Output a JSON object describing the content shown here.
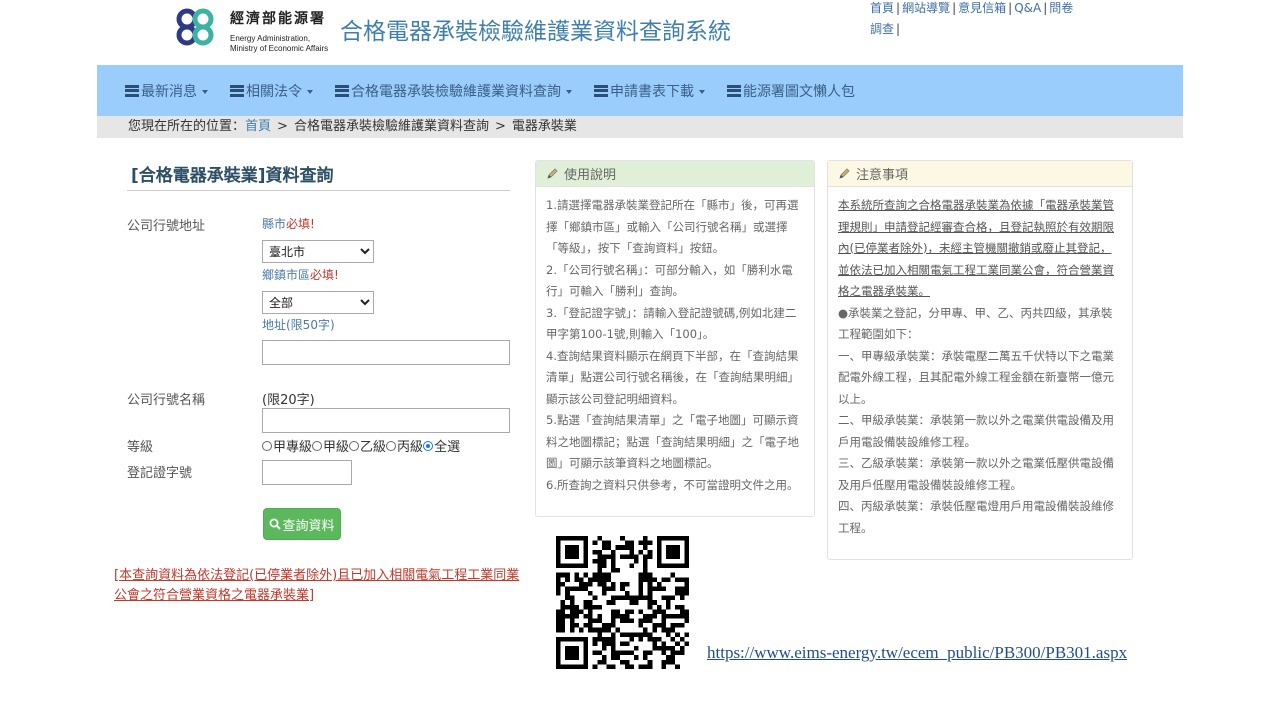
{
  "header": {
    "logo_zh": "經濟部能源署",
    "logo_en_line1": "Energy Administration,",
    "logo_en_line2": "Ministry of Economic Affairs",
    "site_title": "合格電器承裝檢驗維護業資料查詢系統",
    "top_links": [
      "首頁",
      "網站導覽",
      "意見信箱",
      "Q&A",
      "問卷調查"
    ]
  },
  "nav": {
    "items": [
      "最新消息",
      "相關法令",
      "合格電器承裝檢驗維護業資料查詢",
      "申請書表下載",
      "能源署圖文懶人包"
    ]
  },
  "breadcrumb": {
    "prefix": "您現在所在的位置：",
    "home": "首頁",
    "level1": "合格電器承裝檢驗維護業資料查詢",
    "level2": "電器承裝業"
  },
  "form": {
    "title": "[合格電器承裝業]資料查詢",
    "address_label": "公司行號地址",
    "county_label": "縣市",
    "required": "必填!",
    "county_value": "臺北市",
    "district_label": "鄉鎮市區",
    "district_value": "全部",
    "address_hint": "地址(限50字)",
    "address_value": "",
    "name_label": "公司行號名稱",
    "name_hint": "(限20字)",
    "name_value": "",
    "grade_label": "等級",
    "grades": [
      "甲專級",
      "甲級",
      "乙級",
      "丙級",
      "全選"
    ],
    "grade_selected": "全選",
    "reg_label": "登記證字號",
    "reg_value": "",
    "query_button": "查詢資料",
    "red_note": "[本查詢資料為依法登記(已停業者除外)且已加入相關電氣工程工業同業公會之符合營業資格之電器承裝業]"
  },
  "usage": {
    "title": "使用說明",
    "items": [
      "1.請選擇電器承裝業登記所在「縣市」後，可再選擇「鄉鎮市區」或輸入「公司行號名稱」或選擇「等級」，按下「查詢資料」按鈕。",
      "2.「公司行號名稱」：可部分輸入，如「勝利水電行」可輸入「勝利」查詢。",
      "3.「登記證字號」：請輸入登記證號碼,例如北建二甲字第100-1號,則輸入「100」。",
      "4.查詢結果資料顯示在網頁下半部，在「查詢結果清單」點選公司行號名稱後，在「查詢結果明細」顯示該公司登記明細資料。",
      "5.點選「查詢結果清單」之「電子地圖」可顯示資料之地圖標記；點選「查詢結果明細」之「電子地圖」可顯示該筆資料之地圖標記。",
      "6.所查詢之資料只供參考，不可當證明文件之用。"
    ]
  },
  "notice": {
    "title": "注意事項",
    "underlined": "本系統所查詢之合格電器承裝業為依據「電器承裝業管理規則」申請登記經審查合格，且登記執照於有效期限內(已停業者除外)，未經主管機關撤銷或廢止其登記，並依法已加入相關電氣工程工業同業公會，符合營業資格之電器承裝業。",
    "items": [
      "●承裝業之登記，分甲專、甲、乙、丙共四級，其承裝工程範圍如下：",
      "一、甲專級承裝業：承裝電壓二萬五千伏特以下之電業配電外線工程，且其配電外線工程金額在新臺幣一億元以上。",
      "二、甲級承裝業：承裝第一款以外之電業供電設備及用戶用電設備裝設維修工程。",
      "三、乙級承裝業：承裝第一款以外之電業低壓供電設備及用戶低壓用電設備裝設維修工程。",
      "四、丙級承裝業：承裝低壓電燈用戶用電設備裝設維修工程。"
    ]
  },
  "url": "https://www.eims-energy.tw/ecem_public/PB300/PB301.aspx",
  "colors": {
    "nav_bg": "#9bcdfc",
    "breadcrumb_bg": "#e6e6e6",
    "title_blue": "#3f7fb0",
    "button_green": "#5cb85c",
    "required_red": "#c0392b",
    "usage_header": "#e0f0d8",
    "notice_header": "#fcf8e3"
  }
}
